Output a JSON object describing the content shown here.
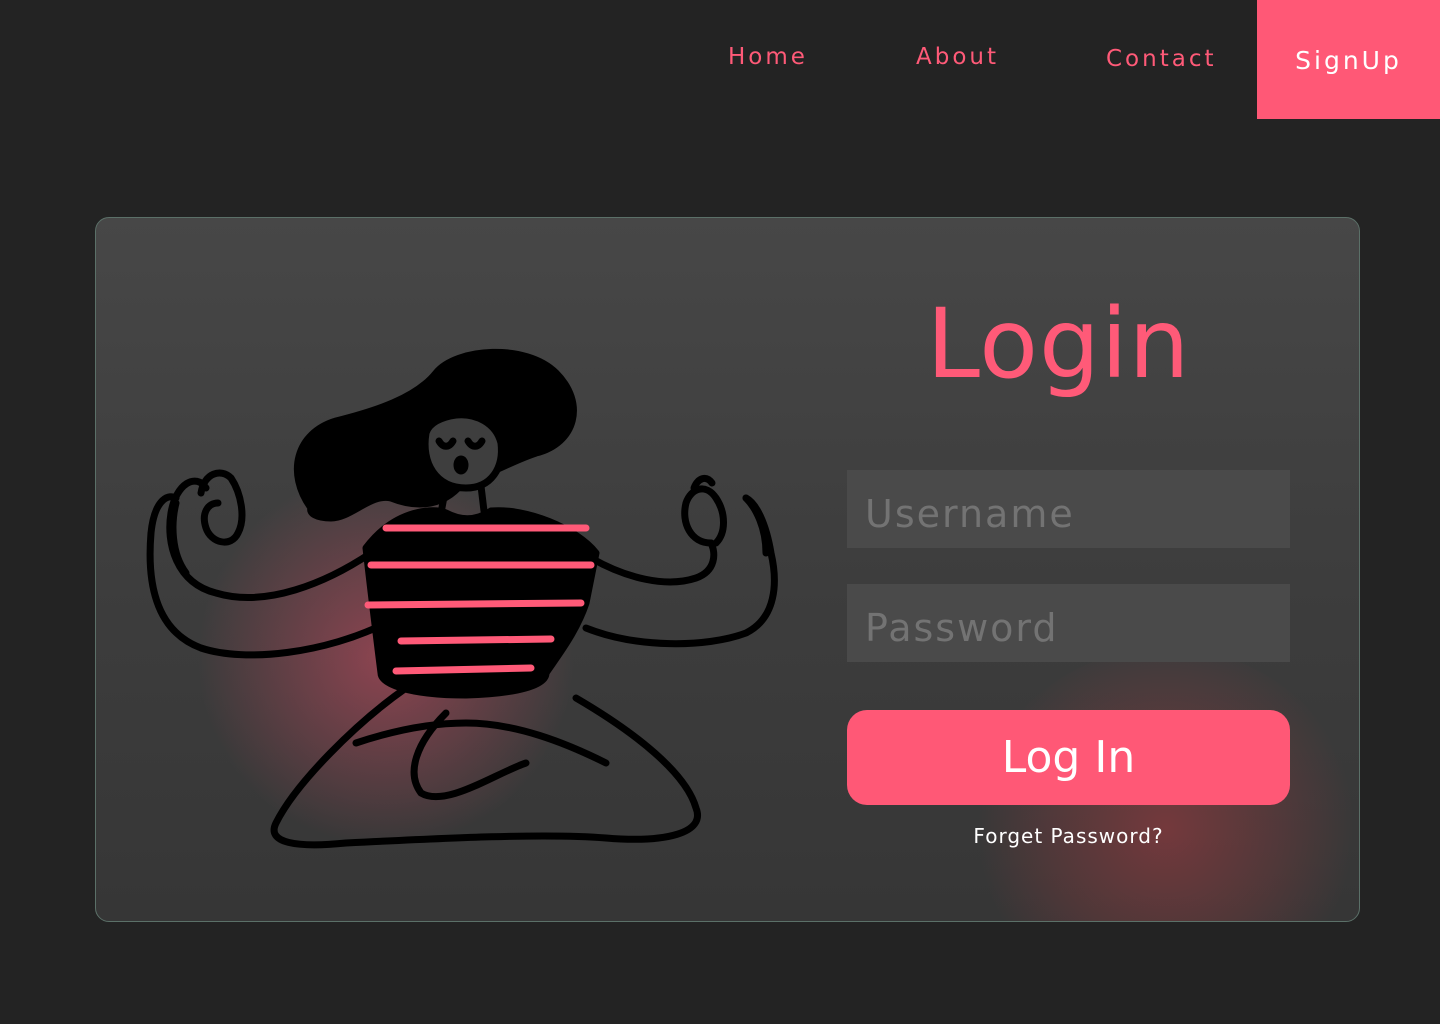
{
  "nav": {
    "home": "Home",
    "about": "About",
    "contact": "Contact",
    "signup": "SignUp"
  },
  "login": {
    "title": "Login",
    "username_placeholder": "Username",
    "password_placeholder": "Password",
    "button_label": "Log In",
    "forget_label": "Forget Password?"
  },
  "illustration": {
    "icon": "meditating-person-illustration"
  },
  "colors": {
    "accent": "#ff5876",
    "background": "#232323",
    "card": "#444444",
    "input": "#4a4a4a"
  }
}
